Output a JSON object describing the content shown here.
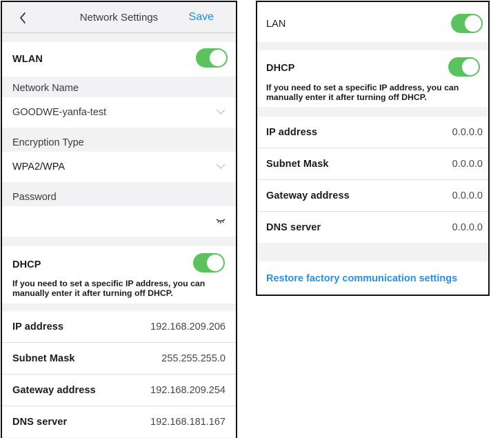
{
  "header": {
    "title": "Network Settings",
    "save_label": "Save",
    "back_icon": "chevron-left-icon"
  },
  "wlan": {
    "label": "WLAN",
    "enabled": true,
    "network_name_label": "Network Name",
    "network_name_value": "GOODWE-yanfa-test",
    "encryption_label": "Encryption Type",
    "encryption_value": "WPA2/WPA",
    "password_label": "Password",
    "password_value": "",
    "password_icon": "eye-closed-icon",
    "dhcp_label": "DHCP",
    "dhcp_enabled": true,
    "dhcp_note": "If you need to set a specific IP address, you can manually enter it after turning off DHCP.",
    "rows": [
      {
        "label": "IP address",
        "value": "192.168.209.206"
      },
      {
        "label": "Subnet Mask",
        "value": "255.255.255.0"
      },
      {
        "label": "Gateway address",
        "value": "192.168.209.254"
      },
      {
        "label": "DNS server",
        "value": "192.168.181.167"
      }
    ]
  },
  "lan": {
    "label": "LAN",
    "enabled": true,
    "dhcp_label": "DHCP",
    "dhcp_enabled": true,
    "dhcp_note": "If you need to set a specific IP address, you can manually enter it after turning off DHCP.",
    "rows": [
      {
        "label": "IP address",
        "value": "0.0.0.0"
      },
      {
        "label": "Subnet Mask",
        "value": "0.0.0.0"
      },
      {
        "label": "Gateway address",
        "value": "0.0.0.0"
      },
      {
        "label": "DNS server",
        "value": "0.0.0.0"
      }
    ],
    "restore_label": "Restore factory communication settings"
  },
  "colors": {
    "toggle_on": "#5bc35e",
    "accent": "#1e88e5",
    "background": "#f2f2f4"
  }
}
